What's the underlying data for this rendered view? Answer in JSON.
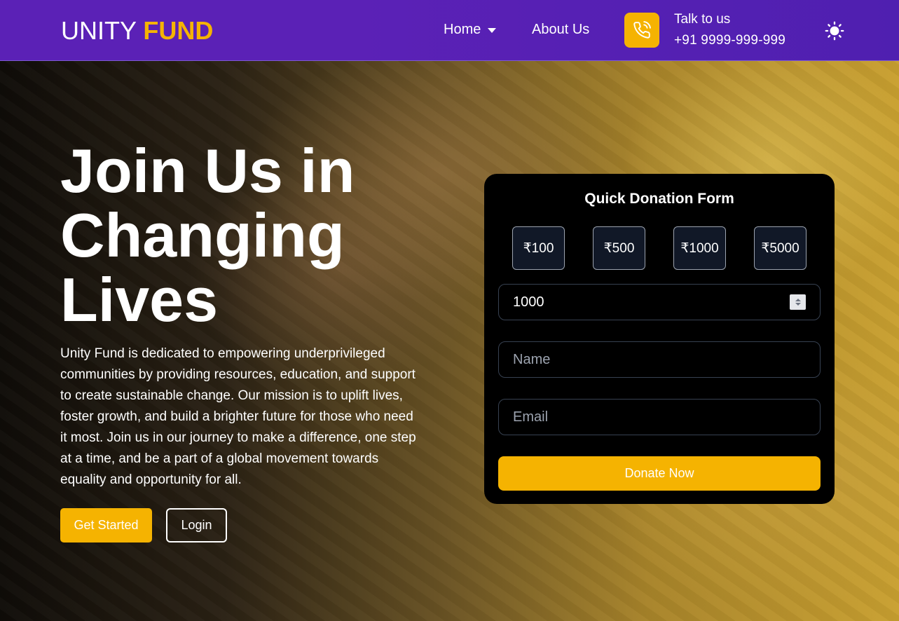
{
  "navbar": {
    "brand_main": "UNITY",
    "brand_accent": "FUND",
    "home_label": "Home",
    "about_label": "About Us",
    "phone_icon": "phone-icon",
    "talk_label": "Talk to us",
    "talk_number": "+91 9999-999-999",
    "theme_icon": "sun-icon"
  },
  "hero": {
    "title": "Join Us in Changing Lives",
    "description": "Unity Fund is dedicated to empowering underprivileged communities by providing resources, education, and support to create sustainable change. Our mission is to uplift lives, foster growth, and build a brighter future for those who need it most. Join us in our journey to make a difference, one step at a time, and be a part of a global movement towards equality and opportunity for all.",
    "get_started_label": "Get Started",
    "login_label": "Login"
  },
  "donation_form": {
    "title": "Quick Donation Form",
    "amounts": [
      "₹100",
      "₹500",
      "₹1000",
      "₹5000"
    ],
    "amount_value": "1000",
    "name_placeholder": "Name",
    "email_placeholder": "Email",
    "submit_label": "Donate Now"
  },
  "colors": {
    "nav_bg": "#5b21b6",
    "accent": "#f5b301",
    "card_bg": "#000000",
    "amount_btn_bg": "#111827"
  }
}
